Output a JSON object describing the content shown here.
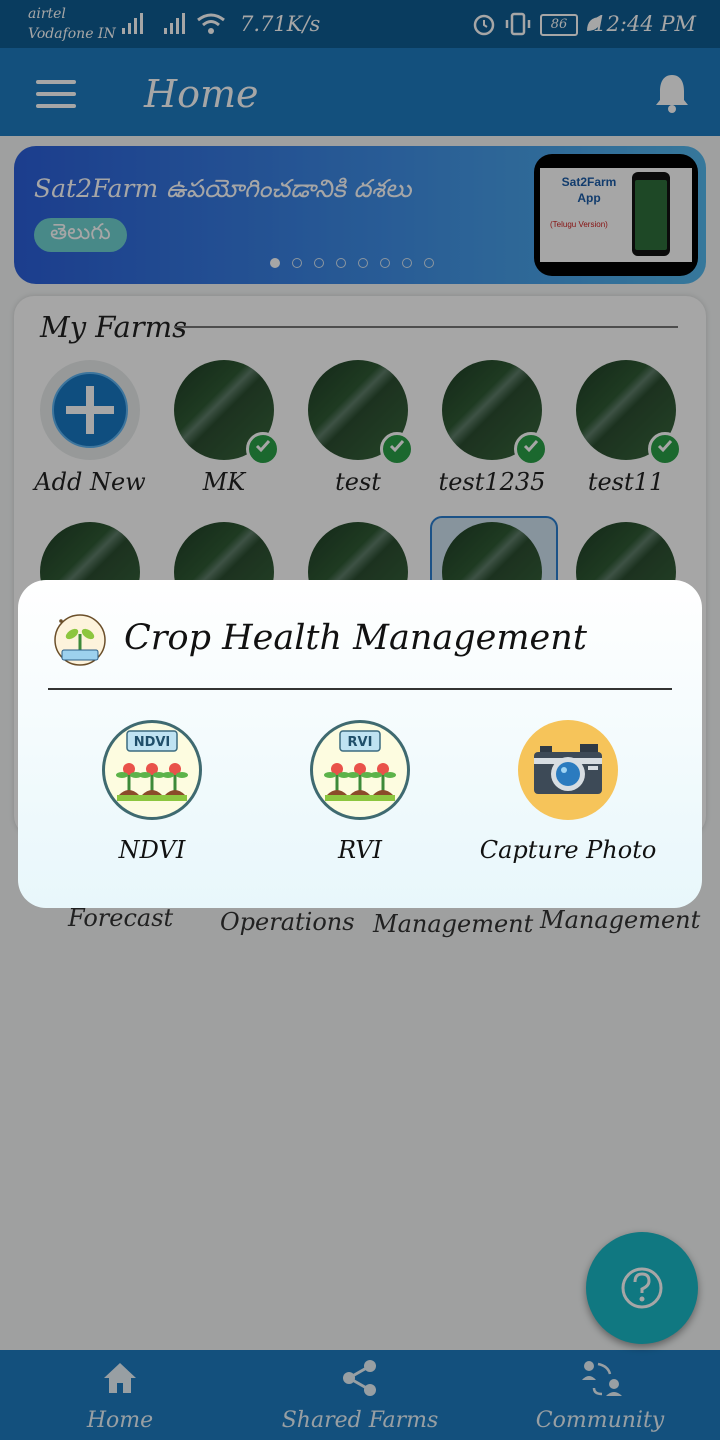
{
  "status_bar": {
    "carrier_primary": "airtel",
    "carrier_secondary": "Vodafone IN",
    "network_speed": "7.71K/s",
    "battery_level": "86",
    "time": "12:44 PM"
  },
  "app_bar": {
    "title": "Home",
    "menu_icon": "hamburger-menu-icon",
    "notification_icon": "bell-icon"
  },
  "banner": {
    "headline": "Sat2Farm ఉపయోగించడానికి దశలు",
    "language_chip": "తెలుగు",
    "card_title": "Sat2Farm App",
    "card_subtitle": "(Telugu Version)",
    "slide_count": 8,
    "active_slide": 1
  },
  "my_farms": {
    "title": "My Farms",
    "add_label": "Add New",
    "farms": [
      {
        "name": "MK",
        "verified": true
      },
      {
        "name": "test",
        "verified": true
      },
      {
        "name": "test1235",
        "verified": true
      },
      {
        "name": "test11",
        "verified": true
      }
    ]
  },
  "background_labels": [
    "Forecast",
    "Operations",
    "Management",
    "Management"
  ],
  "dialog": {
    "title": "Crop Health Management",
    "options": [
      {
        "label": "NDVI",
        "badge": "NDVI",
        "icon": "ndvi-plants-icon"
      },
      {
        "label": "RVI",
        "badge": "RVI",
        "icon": "rvi-plants-icon"
      },
      {
        "label": "Capture Photo",
        "icon": "camera-icon"
      }
    ]
  },
  "bottom_nav": {
    "items": [
      {
        "label": "Home",
        "icon": "home-icon"
      },
      {
        "label": "Shared Farms",
        "icon": "share-icon"
      },
      {
        "label": "Community",
        "icon": "community-icon"
      }
    ]
  },
  "colors": {
    "primary": "#1e7cc0",
    "status_bar": "#0f5d92",
    "fab": "#19b9c6",
    "verified": "#2aa047"
  }
}
